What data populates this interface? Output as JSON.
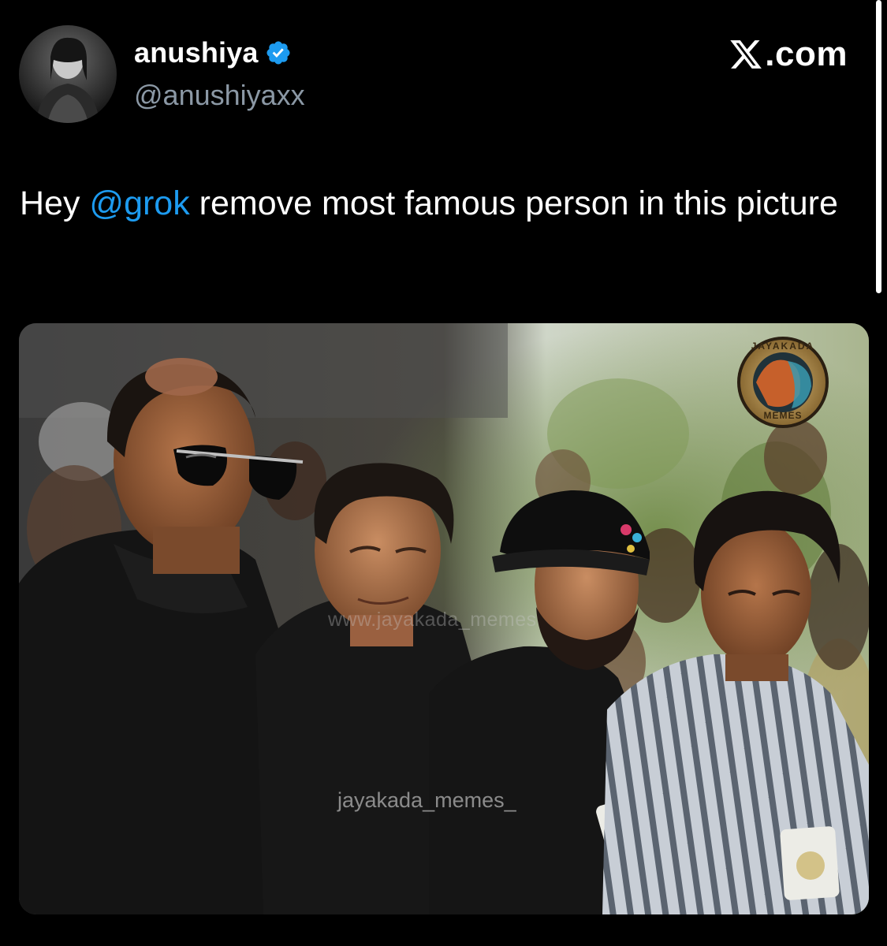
{
  "author": {
    "display_name": "anushiya",
    "handle": "@anushiyaxx",
    "verified_icon": "verified-badge-icon"
  },
  "brand": {
    "suffix": ".com",
    "icon": "x-logo-icon"
  },
  "tweet": {
    "prefix": "Hey ",
    "mention": "@grok",
    "suffix": " remove most famous person in this picture"
  },
  "media": {
    "watermark_mid": "www.jayakada_memes",
    "watermark_bottom": "jayakada_memes_",
    "badge_arc": "JAYAKADA",
    "badge_label": "MEMES"
  },
  "colors": {
    "background": "#000000",
    "text": "#ffffff",
    "secondary": "#8b98a5",
    "link": "#1d9bf0",
    "verified": "#1d9bf0"
  }
}
